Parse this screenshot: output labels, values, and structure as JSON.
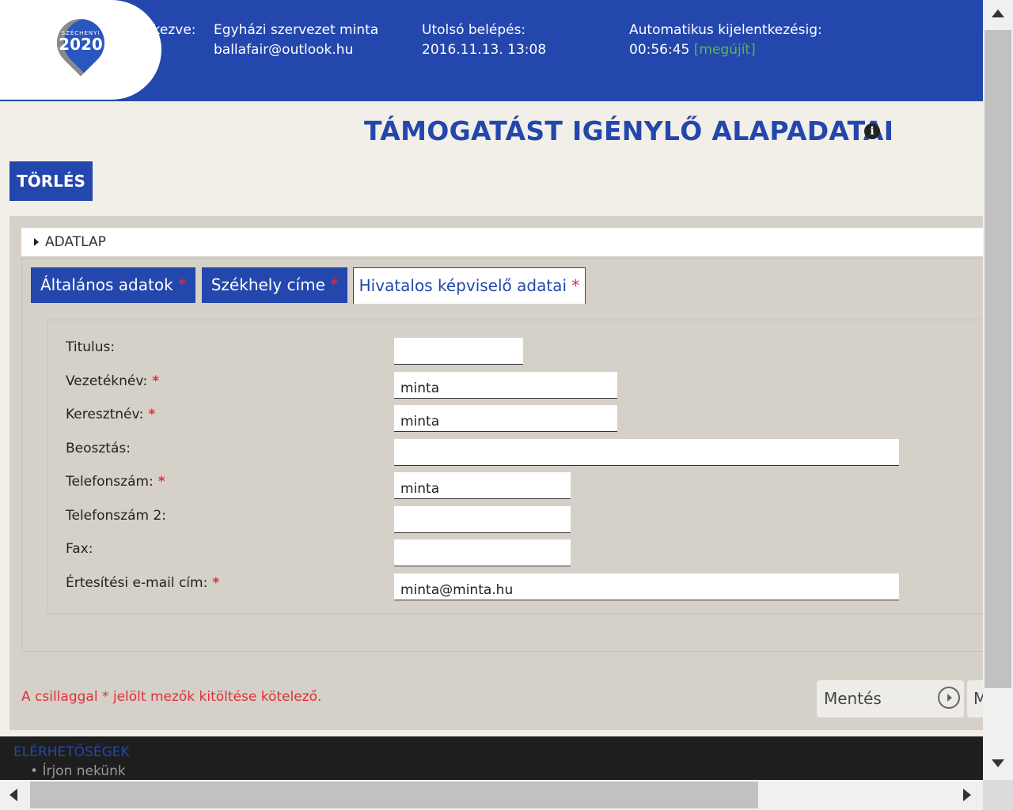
{
  "header": {
    "logo": {
      "small": "SZÉCHENYI",
      "big": "2020"
    },
    "login_label": "tkezve:",
    "org_name": "Egyházi szervezet minta",
    "email": "ballafair@outlook.hu",
    "last_login_label": "Utolsó belépés:",
    "last_login_value": "2016.11.13. 13:08",
    "auto_logout_label": "Automatikus kijelentkezésig:",
    "auto_logout_time": "00:56:45",
    "renew_label": "[megújít]"
  },
  "page": {
    "title": "TÁMOGATÁST IGÉNYLŐ ALAPADATAI",
    "info_icon": "i",
    "delete_button": "TÖRLÉS"
  },
  "section": {
    "label": "ADATLAP"
  },
  "tabs": [
    {
      "label": "Általános adatok",
      "star": "*"
    },
    {
      "label": "Székhely címe",
      "star": "*"
    },
    {
      "label": "Hivatalos képviselő adatai",
      "star": "*"
    }
  ],
  "form": {
    "required_mark": "*",
    "fields": [
      {
        "label": "Titulus:",
        "value": ""
      },
      {
        "label": "Vezetéknév:",
        "value": "minta"
      },
      {
        "label": "Keresztnév:",
        "value": "minta"
      },
      {
        "label": "Beosztás:",
        "value": ""
      },
      {
        "label": "Telefonszám:",
        "value": "minta"
      },
      {
        "label": "Telefonszám 2:",
        "value": ""
      },
      {
        "label": "Fax:",
        "value": ""
      },
      {
        "label": "Értesítési e-mail cím:",
        "value": "minta@minta.hu"
      }
    ]
  },
  "mandatory_note": "A csillaggal * jelölt mezők kitöltése kötelező.",
  "buttons": {
    "save": "Mentés",
    "next_partial": "M"
  },
  "footer": {
    "title": "ELÉRHETŐSÉGEK",
    "item": "Írjon nekünk"
  },
  "colors": {
    "brand": "#2447ad",
    "required": "#e0303a",
    "renew": "#5bb35b"
  }
}
